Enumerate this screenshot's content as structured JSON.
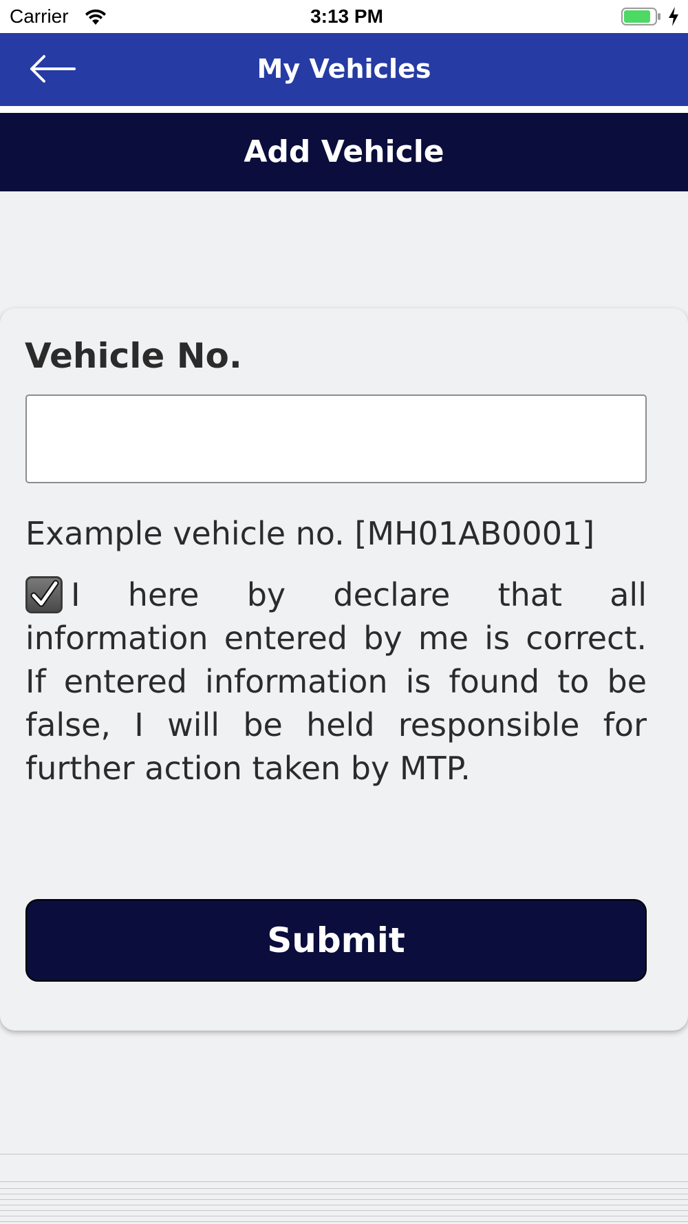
{
  "status_bar": {
    "carrier": "Carrier",
    "time": "3:13 PM",
    "battery_color": "#4cd964"
  },
  "nav": {
    "back_icon": "arrow-left-icon",
    "title": "My Vehicles",
    "color": "#263ba3"
  },
  "section": {
    "title": "Add Vehicle",
    "color": "#0b0d3c"
  },
  "form": {
    "vehicle_label": "Vehicle No.",
    "vehicle_value": "",
    "example": "Example vehicle no. [MH01AB0001]",
    "declaration_checked": true,
    "declaration": "I here by declare that all information entered by me is correct. If entered information is found to be false, I will be held responsible for further action taken by MTP.",
    "submit_label": "Submit"
  }
}
